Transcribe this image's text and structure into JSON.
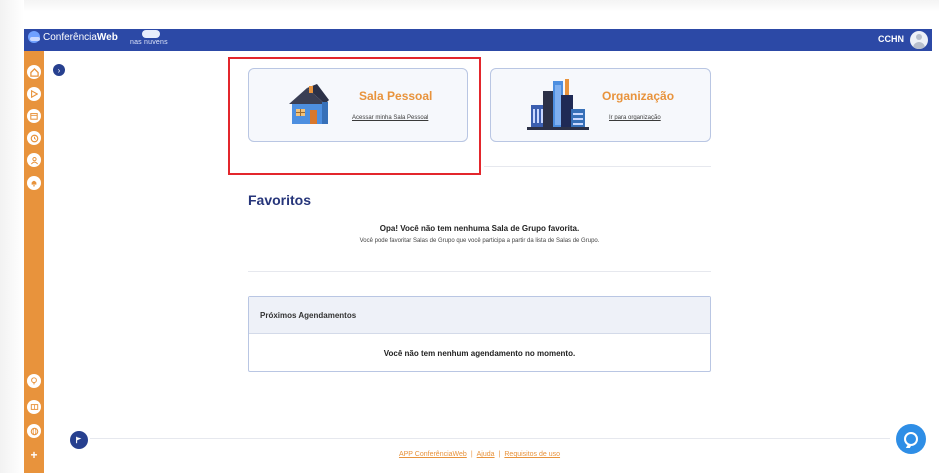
{
  "topbar": {
    "brand_prefix": "Conferência",
    "brand_suffix": "Web",
    "cloud_text": "nas nuvens",
    "user": "CCHN"
  },
  "sidebar": {
    "icons": [
      "home-icon",
      "play-icon",
      "calendar-icon",
      "history-icon",
      "group-icon",
      "bell-icon",
      "lightbulb-icon",
      "book-icon",
      "globe-icon",
      "plus-icon"
    ]
  },
  "cards": {
    "personal": {
      "title": "Sala Pessoal",
      "link": "Acessar minha Sala Pessoal"
    },
    "organization": {
      "title": "Organização",
      "link": "Ir para organização"
    }
  },
  "favorites": {
    "title": "Favoritos",
    "message": "Opa! Você não tem nenhuma Sala de Grupo favorita.",
    "submessage": "Você pode favoritar Salas de Grupo que você participa a partir da lista de Salas de Grupo."
  },
  "schedule": {
    "title": "Próximos Agendamentos",
    "empty": "Você não tem nenhum agendamento no momento."
  },
  "footer": {
    "app": "APP ConferênciaWeb",
    "help": "Ajuda",
    "requirements": "Requisitos de uso",
    "separator": "|"
  },
  "colors": {
    "topbar": "#2c49a6",
    "sidebar": "#e8933c",
    "accent": "#e8933c",
    "heading": "#26357a",
    "highlight": "#e3262c"
  }
}
